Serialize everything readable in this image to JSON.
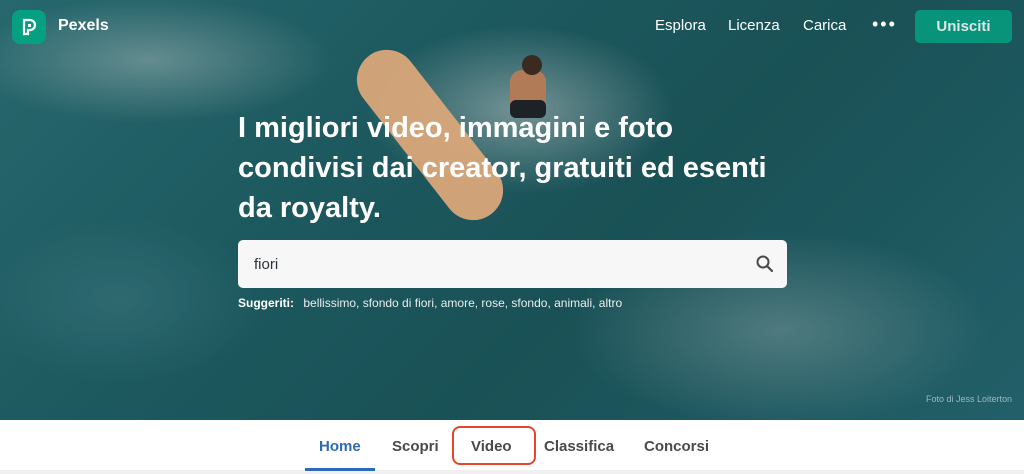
{
  "header": {
    "brand": "Pexels",
    "nav": [
      "Esplora",
      "Licenza",
      "Carica"
    ],
    "more_label": "•••",
    "join_label": "Unisciti"
  },
  "hero": {
    "headline": "I migliori video, immagini e foto condivisi dai creator, gratuiti ed esenti da royalty.",
    "search": {
      "value": "fiori"
    },
    "suggestions_label": "Suggeriti:",
    "suggestions": "bellissimo, sfondo di fiori, amore, rose, sfondo, animali, altro",
    "photo_credit": "Foto di Jess Loiterton"
  },
  "tabs": [
    "Home",
    "Scopri",
    "Video",
    "Classifica",
    "Concorsi"
  ],
  "colors": {
    "brand": "#05a081",
    "active_tab": "#2f6ab8",
    "highlight": "#e8452a"
  }
}
